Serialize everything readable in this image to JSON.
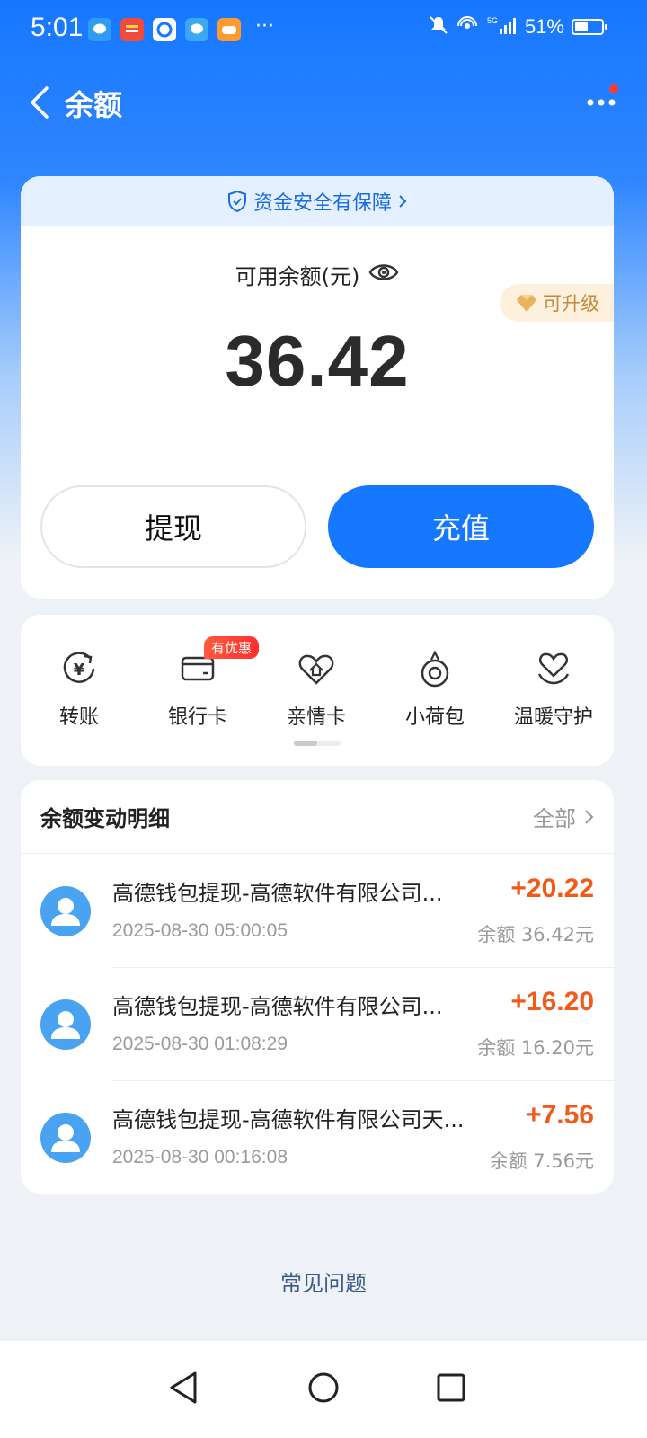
{
  "status_bar": {
    "time": "5:01",
    "app_icons": [
      "chat-app-icon",
      "wallet-app-icon",
      "browser-app-icon",
      "message-app-icon",
      "game-app-icon"
    ],
    "overflow": "···",
    "battery_text": "51%",
    "battery_level": 0.51,
    "network": "5G"
  },
  "header": {
    "title": "余额",
    "has_notification_dot": true
  },
  "balance_card": {
    "safety_text": "资金安全有保障",
    "label": "可用余额(元)",
    "amount": "36.42",
    "upgrade_tag": "可升级",
    "withdraw_label": "提现",
    "recharge_label": "充值"
  },
  "quick_actions": {
    "items": [
      {
        "label": "转账",
        "icon": "transfer-icon"
      },
      {
        "label": "银行卡",
        "icon": "bank-card-icon",
        "badge": "有优惠"
      },
      {
        "label": "亲情卡",
        "icon": "family-card-icon"
      },
      {
        "label": "小荷包",
        "icon": "small-purse-icon"
      },
      {
        "label": "温暖守护",
        "icon": "warm-guard-icon"
      }
    ]
  },
  "transactions": {
    "title": "余额变动明细",
    "all_label": "全部",
    "items": [
      {
        "name": "高德钱包提现-高德软件有限公司...",
        "time": "2025-08-30 05:00:05",
        "amount": "+20.22",
        "balance": "余额 36.42元"
      },
      {
        "name": "高德钱包提现-高德软件有限公司...",
        "time": "2025-08-30 01:08:29",
        "amount": "+16.20",
        "balance": "余额 16.20元"
      },
      {
        "name": "高德钱包提现-高德软件有限公司天...",
        "time": "2025-08-30 00:16:08",
        "amount": "+7.56",
        "balance": "余额 7.56元"
      }
    ]
  },
  "faq_label": "常见问题",
  "colors": {
    "brand_blue": "#1677ff",
    "amount_orange": "#f05b1c",
    "upgrade_gold": "#c08a3e"
  }
}
